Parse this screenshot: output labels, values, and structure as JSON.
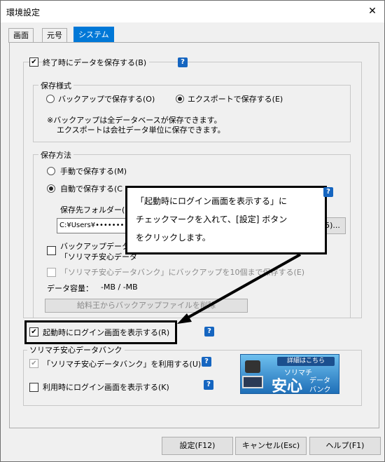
{
  "window": {
    "title": "環境設定",
    "close_symbol": "✕"
  },
  "tabs": [
    {
      "label": "画面"
    },
    {
      "label": "元号"
    },
    {
      "label": "システム"
    }
  ],
  "save_on_exit": {
    "label": "終了時にデータを保存する(B)",
    "checked": true
  },
  "save_format": {
    "group_label": "保存様式",
    "option_backup": "バックアップで保存する(O)",
    "option_export": "エクスポートで保存する(E)",
    "note_line1": "※バックアップは全データベースが保存できます。",
    "note_line2": "エクスポートは会社データ単位に保存できます。"
  },
  "save_method": {
    "group_label": "保存方法",
    "option_manual": "手動で保存する(M)",
    "option_auto": "自動で保存する(C",
    "folder_label": "保存先フォルダー(F",
    "folder_value": "C:¥Users¥•••••••",
    "browse_label": "5)...",
    "backup_line1": "バックアップデータを",
    "backup_line2": "「ソリマチ安心データ",
    "backup10_label": "「ソリマチ安心データバンク」にバックアップを10個まで保存する(E)",
    "capacity_label": "データ容量：",
    "capacity_value": "-MB / -MB",
    "delete_button": "給料王からバックアップファイルを削除"
  },
  "show_login": {
    "label": "起動時にログイン画面を表示する(R)",
    "checked": true
  },
  "databank": {
    "group_label": "ソリマチ安心データバンク",
    "use_label": "「ソリマチ安心データバンク」を利用する(U)",
    "login_label": "利用時にログイン画面を表示する(K)",
    "banner_top": "詳細はこちら",
    "banner_brand": "ソリマチ",
    "banner_main": "安心",
    "banner_sub1": "データ",
    "banner_sub2": "バンク"
  },
  "help_mark": "?",
  "callout": {
    "line1": "「起動時にログイン画面を表示する」に",
    "line2": "チェックマークを入れて、[設定] ボタン",
    "line3": "をクリックします。"
  },
  "footer": {
    "settings": "設定(F12)",
    "cancel": "キャンセル(Esc)",
    "help": "ヘルプ(F1)"
  }
}
